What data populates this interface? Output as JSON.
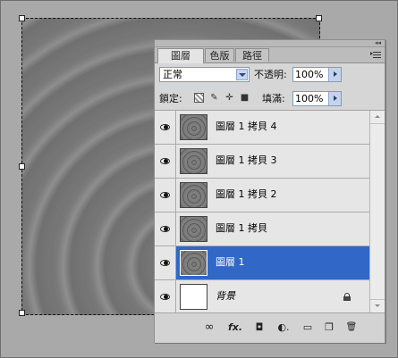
{
  "canvas": {
    "description": "concentric-rings"
  },
  "panel": {
    "tabs": [
      {
        "label": "圖層",
        "active": true
      },
      {
        "label": "色版",
        "active": false
      },
      {
        "label": "路徑",
        "active": false
      }
    ],
    "blend_mode": "正常",
    "opacity_label": "不透明:",
    "opacity_value": "100%",
    "lock_label": "鎖定:",
    "fill_label": "填滿:",
    "fill_value": "100%",
    "layers": [
      {
        "name": "圖層 1 拷貝 4",
        "visible": true,
        "selected": false
      },
      {
        "name": "圖層 1 拷貝 3",
        "visible": true,
        "selected": false
      },
      {
        "name": "圖層 1 拷貝 2",
        "visible": true,
        "selected": false
      },
      {
        "name": "圖層 1 拷貝",
        "visible": true,
        "selected": false
      },
      {
        "name": "圖層 1",
        "visible": true,
        "selected": true
      },
      {
        "name": "背景",
        "visible": true,
        "selected": false,
        "locked": true
      }
    ],
    "footer": {
      "link": "∞",
      "fx": "fx.",
      "mask": "◘",
      "adjust": "◐.",
      "folder": "▭",
      "new": "❐",
      "trash": "🗑"
    }
  },
  "colors": {
    "selected_row": "#3168c8",
    "canvas": "#757575",
    "workspace": "#a9a9a9"
  }
}
